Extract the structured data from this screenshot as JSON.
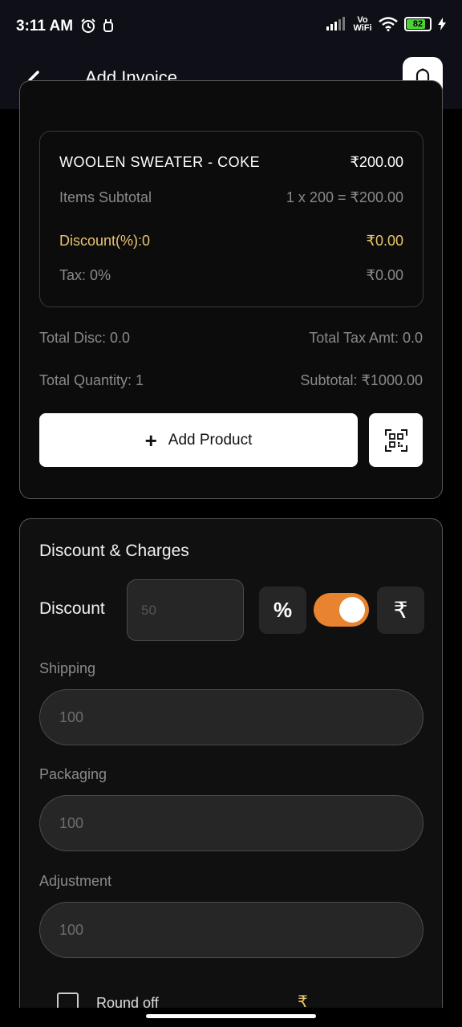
{
  "status_bar": {
    "time": "3:11 AM",
    "vowifi": "Vo WiFi",
    "battery": "82"
  },
  "app_bar": {
    "title": "Add Invoice"
  },
  "product": {
    "name": "WOOLEN SWEATER - COKE",
    "price": "₹200.00",
    "subtotal_label": "Items Subtotal",
    "subtotal_value": "1 x 200 = ₹200.00",
    "discount_label": "Discount(%):0",
    "discount_value": "₹0.00",
    "tax_label": "Tax: 0%",
    "tax_value": "₹0.00"
  },
  "totals": {
    "total_disc": "Total Disc: 0.0",
    "total_tax": "Total Tax Amt: 0.0",
    "total_quantity": "Total Quantity: 1",
    "subtotal": "Subtotal: ₹1000.00"
  },
  "actions": {
    "add_product_label": "Add Product"
  },
  "discount_charges": {
    "title": "Discount & Charges",
    "discount_label": "Discount",
    "discount_placeholder": "50",
    "percent_symbol": "%",
    "rupee_symbol": "₹",
    "toggle_on": true,
    "shipping_label": "Shipping",
    "shipping_value": "100",
    "packaging_label": "Packaging",
    "packaging_value": "100",
    "adjustment_label": "Adjustment",
    "adjustment_value": "100",
    "round_off_label": "Round off",
    "round_off_symbol": "₹"
  },
  "colors": {
    "accent": "#e8832f",
    "gold": "#e9c46a",
    "background": "#000000"
  }
}
